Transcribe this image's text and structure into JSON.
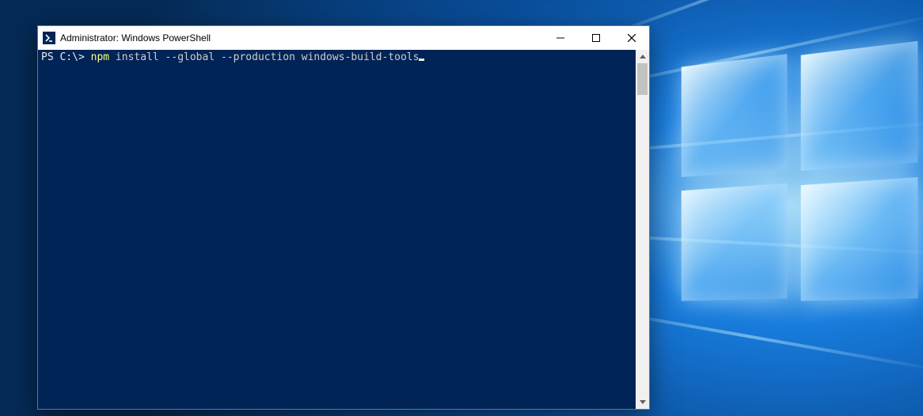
{
  "window": {
    "title": "Administrator: Windows PowerShell"
  },
  "terminal": {
    "prompt": "PS C:\\> ",
    "command": "npm",
    "args": " install --global --production windows-build-tools"
  },
  "controls": {
    "minimize": "minimize",
    "maximize": "maximize",
    "close": "close"
  },
  "colors": {
    "terminal_bg": "#012456",
    "command_color": "#fefe7e",
    "text_color": "#eeeeee"
  }
}
